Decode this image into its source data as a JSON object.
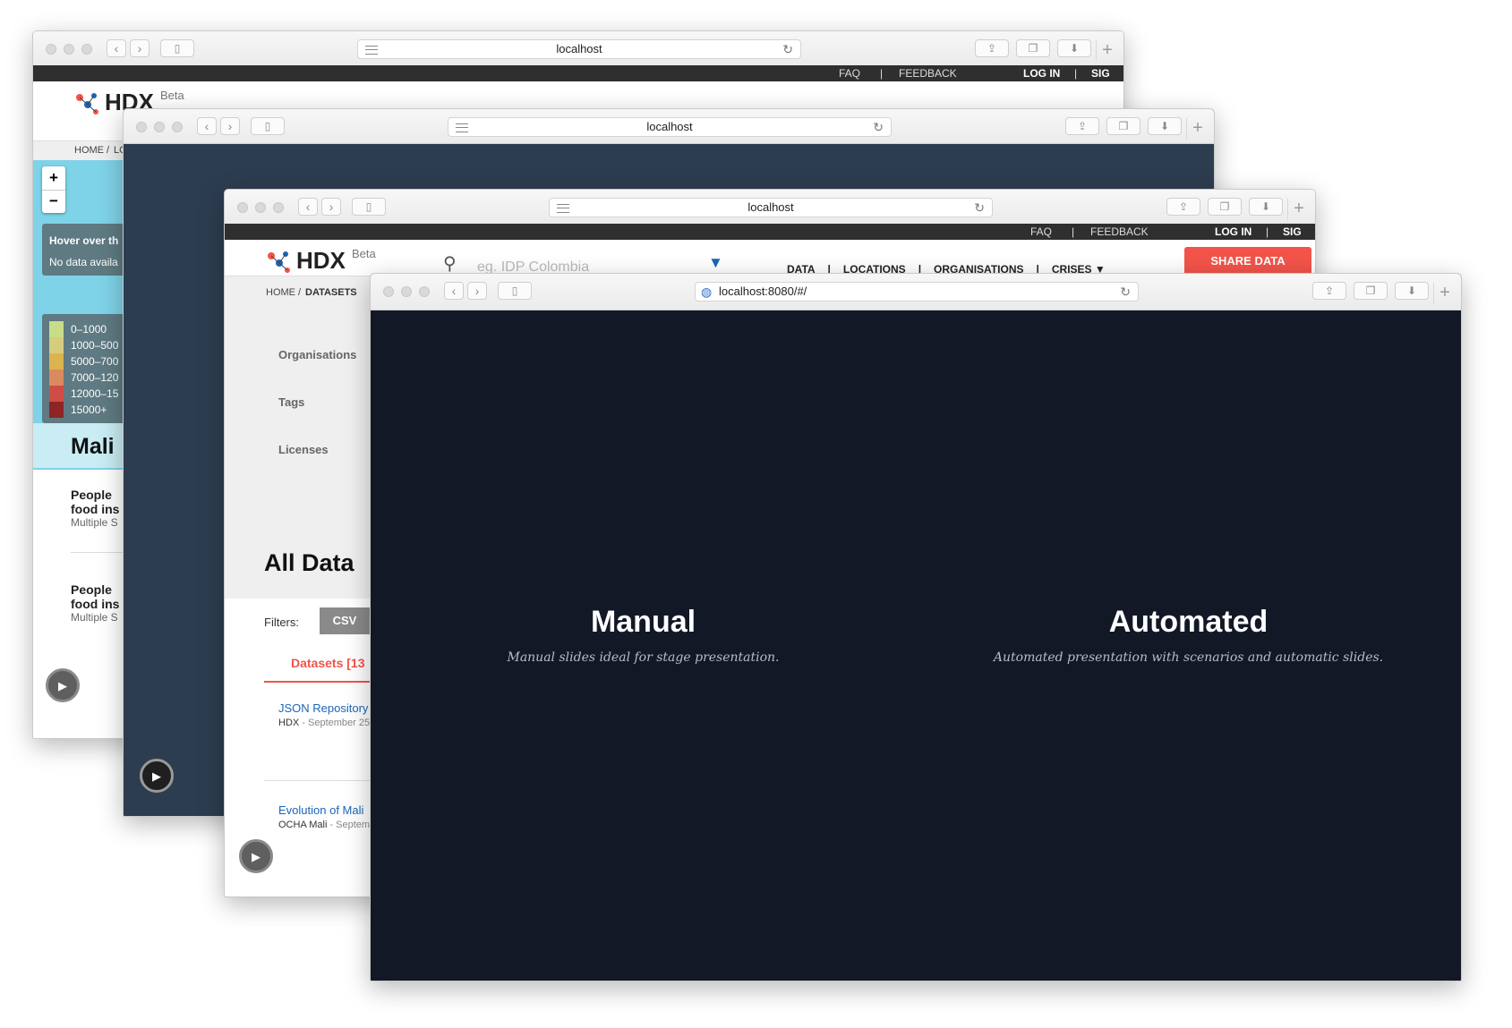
{
  "windows": {
    "w1": {
      "url": "localhost",
      "topbar": {
        "faq": "FAQ",
        "sep1": "|",
        "feedback": "FEEDBACK",
        "login": "LOG IN",
        "sep2": "|",
        "signup": "SIG"
      },
      "logo": {
        "name": "HDX",
        "tag": "Beta"
      },
      "search_placeholder": "IDP Colombia",
      "menu": [
        "DATA",
        "LOCATIONS",
        "ORGANISATIONS",
        "CRISES"
      ],
      "share": "SHARE DATA",
      "breadcrumb": {
        "home": "HOME",
        "sep": "/",
        "current": "LO"
      },
      "zoom": {
        "in": "+",
        "out": "−"
      },
      "hover": {
        "title": "Hover over th",
        "text": "No data availa"
      },
      "legend": [
        {
          "label": "0–1000",
          "color": "#c9dc8a"
        },
        {
          "label": "1000–500",
          "color": "#d6cc7d"
        },
        {
          "label": "5000–700",
          "color": "#dcb44e"
        },
        {
          "label": "7000–120",
          "color": "#d98a5e"
        },
        {
          "label": "12000–15",
          "color": "#cf4d46"
        },
        {
          "label": "15000+",
          "color": "#8e2424"
        }
      ],
      "country": "Mali",
      "items": [
        {
          "l1": "People",
          "l2": "food ins",
          "src": "Multiple S"
        },
        {
          "l1": "People",
          "l2": "food ins",
          "src": "Multiple S"
        }
      ]
    },
    "w2": {
      "url": "localhost"
    },
    "w3": {
      "url": "localhost",
      "topbar": {
        "faq": "FAQ",
        "sep1": "|",
        "feedback": "FEEDBACK",
        "login": "LOG IN",
        "sep2": "|",
        "signup": "SIG"
      },
      "logo": {
        "name": "HDX",
        "tag": "Beta"
      },
      "search_placeholder": "eg. IDP Colombia",
      "menu": [
        "DATA",
        "|",
        "LOCATIONS",
        "|",
        "ORGANISATIONS",
        "|",
        "CRISES ▼"
      ],
      "share": "SHARE DATA",
      "breadcrumb": {
        "home": "HOME",
        "sep": "/",
        "current": "DATASETS"
      },
      "facets": [
        "Organisations",
        "Tags",
        "Licenses"
      ],
      "heading": "All Data",
      "filters_label": "Filters:",
      "filter_chip": "CSV",
      "tab": "Datasets [13",
      "datasets": [
        {
          "title": "JSON Repository",
          "org": "HDX",
          "meta": " - September 25"
        },
        {
          "title": "Evolution of Mali",
          "org": "OCHA Mali",
          "meta": " - Septem"
        }
      ]
    },
    "w4": {
      "url": "localhost:8080/#/",
      "options": [
        {
          "title": "Manual",
          "desc": "Manual slides ideal for stage presentation."
        },
        {
          "title": "Automated",
          "desc": "Automated presentation with scenarios and automatic slides."
        }
      ]
    }
  },
  "colors": {
    "hdx_red": "#f2544a",
    "dark_slate": "#2d3d50",
    "navy": "#121826",
    "map_blue": "#7fd3e8",
    "link_blue": "#1a66b8"
  }
}
